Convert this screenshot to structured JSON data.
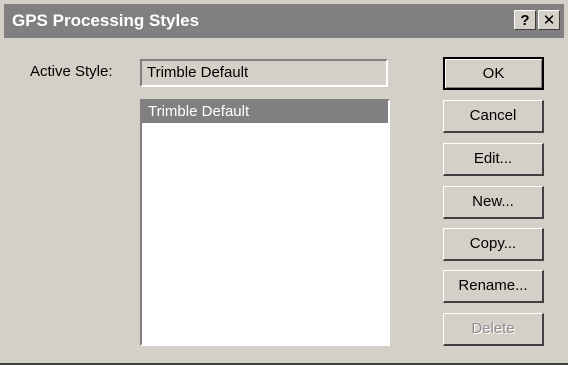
{
  "window": {
    "title": "GPS Processing Styles",
    "help_label": "?",
    "close_label": "✕"
  },
  "active_style": {
    "label": "Active Style:",
    "value": "Trimble Default"
  },
  "styles_list": {
    "items": [
      {
        "label": "Trimble Default",
        "selected": true
      }
    ]
  },
  "buttons": {
    "ok": "OK",
    "cancel": "Cancel",
    "edit": "Edit...",
    "new": "New...",
    "copy": "Copy...",
    "rename": "Rename...",
    "delete": "Delete"
  },
  "colors": {
    "dialog_face": "#d4d0c8",
    "titlebar_inactive": "#808080",
    "selection": "#808080",
    "disabled_text": "#8e8e8e"
  }
}
